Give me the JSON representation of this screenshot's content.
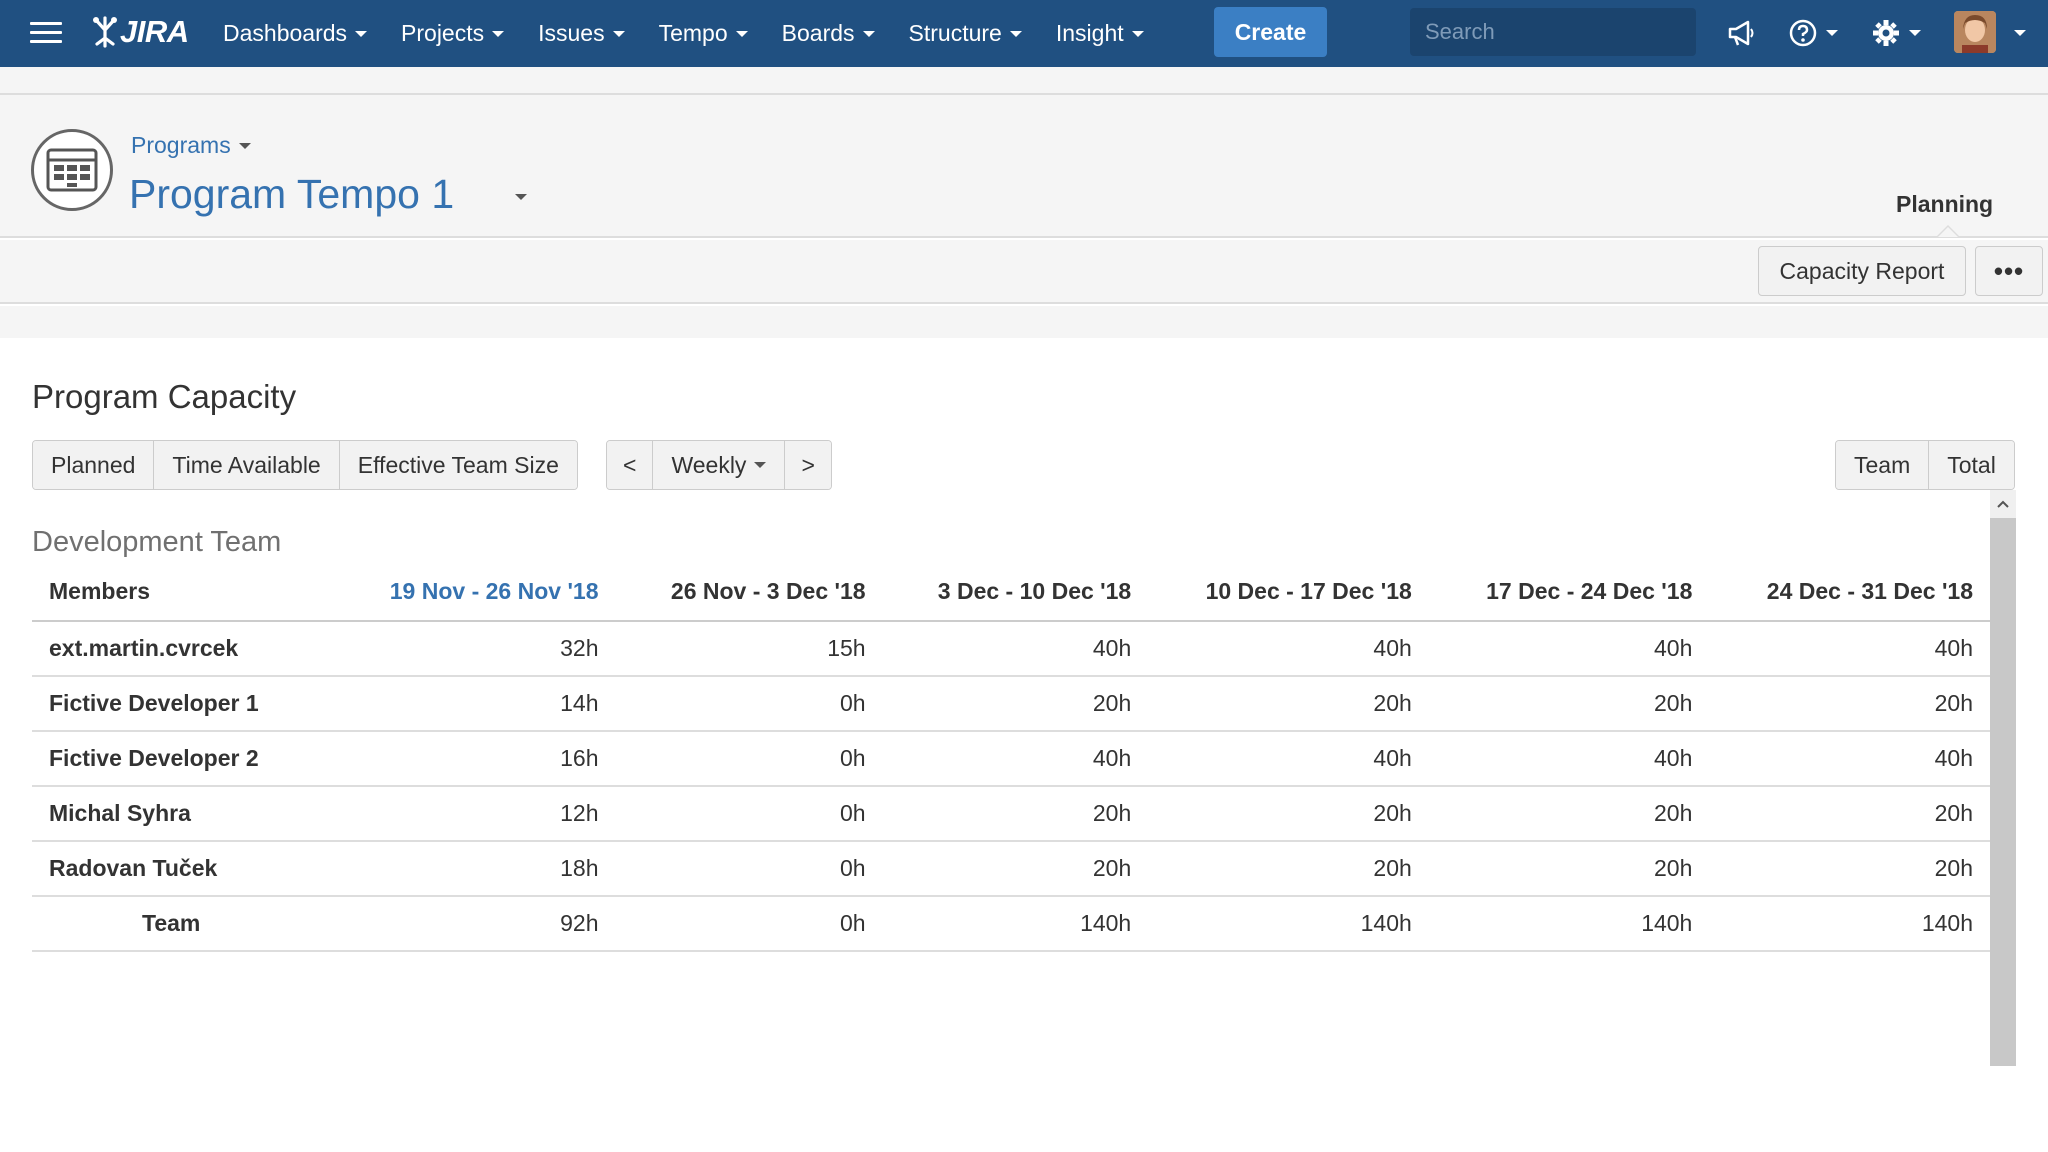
{
  "nav": {
    "logo_text": "JIRA",
    "menu": [
      {
        "label": "Dashboards"
      },
      {
        "label": "Projects"
      },
      {
        "label": "Issues"
      },
      {
        "label": "Tempo"
      },
      {
        "label": "Boards"
      },
      {
        "label": "Structure"
      },
      {
        "label": "Insight"
      }
    ],
    "create_label": "Create",
    "search_placeholder": "Search",
    "icons": [
      "megaphone-icon",
      "help-icon",
      "gear-icon"
    ]
  },
  "header": {
    "breadcrumb": "Programs",
    "title": "Program Tempo 1",
    "active_tab": "Planning"
  },
  "toolbar": {
    "capacity_report_label": "Capacity Report",
    "more_label": "•••"
  },
  "main": {
    "section_title": "Program Capacity",
    "metric_buttons": [
      "Planned",
      "Time Available",
      "Effective Team Size"
    ],
    "period": {
      "prev": "<",
      "label": "Weekly",
      "next": ">"
    },
    "view_buttons": [
      "Team",
      "Total"
    ]
  },
  "team": {
    "name": "Development Team",
    "columns": [
      "Members",
      "19 Nov - 26 Nov '18",
      "26 Nov - 3 Dec '18",
      "3 Dec - 10 Dec '18",
      "10 Dec - 17 Dec '18",
      "17 Dec - 24 Dec '18",
      "24 Dec - 31 Dec '18"
    ],
    "rows": [
      {
        "name": "ext.martin.cvrcek",
        "values": [
          "32h",
          "15h",
          "40h",
          "40h",
          "40h",
          "40h"
        ]
      },
      {
        "name": "Fictive Developer 1",
        "values": [
          "14h",
          "0h",
          "20h",
          "20h",
          "20h",
          "20h"
        ]
      },
      {
        "name": "Fictive Developer 2",
        "values": [
          "16h",
          "0h",
          "40h",
          "40h",
          "40h",
          "40h"
        ]
      },
      {
        "name": "Michal Syhra",
        "values": [
          "12h",
          "0h",
          "20h",
          "20h",
          "20h",
          "20h"
        ]
      },
      {
        "name": "Radovan Tuček",
        "values": [
          "18h",
          "0h",
          "20h",
          "20h",
          "20h",
          "20h"
        ]
      }
    ],
    "total": {
      "label": "Team",
      "values": [
        "92h",
        "0h",
        "140h",
        "140h",
        "140h",
        "140h"
      ]
    }
  },
  "colors": {
    "nav_bg": "#205081",
    "link": "#3572b0",
    "create_bg": "#3b7fc4"
  }
}
